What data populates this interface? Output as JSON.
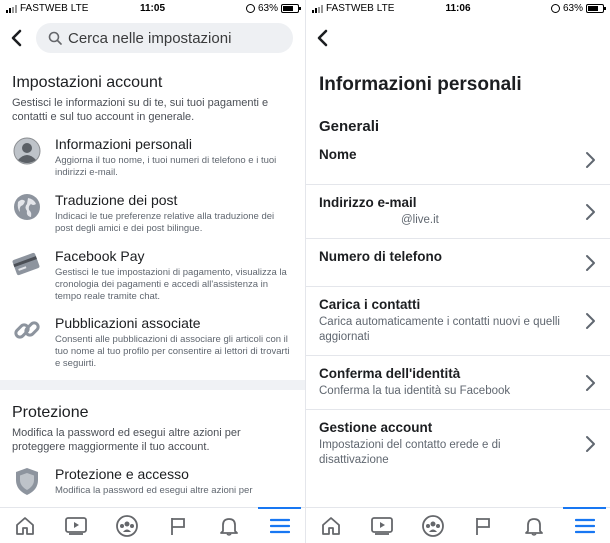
{
  "status_left": {
    "carrier": "FASTWEB",
    "network": "LTE",
    "time": "11:05",
    "battery": "63%"
  },
  "status_right": {
    "carrier": "FASTWEB",
    "network": "LTE",
    "time": "11:06",
    "battery": "63%"
  },
  "search": {
    "placeholder": "Cerca nelle impostazioni"
  },
  "settings": {
    "account": {
      "title": "Impostazioni account",
      "desc": "Gestisci le informazioni su di te, sui tuoi pagamenti e contatti e sul tuo account in generale.",
      "items": [
        {
          "label": "Informazioni personali",
          "desc": "Aggiorna il tuo nome, i tuoi numeri di telefono e i tuoi indirizzi e-mail.",
          "icon": "person-icon"
        },
        {
          "label": "Traduzione dei post",
          "desc": "Indicaci le tue preferenze relative alla traduzione dei post degli amici e dei post bilingue.",
          "icon": "globe-icon"
        },
        {
          "label": "Facebook Pay",
          "desc": "Gestisci le tue impostazioni di pagamento, visualizza la cronologia dei pagamenti e accedi all'assistenza in tempo reale tramite chat.",
          "icon": "credit-card-icon"
        },
        {
          "label": "Pubblicazioni associate",
          "desc": "Consenti alle pubblicazioni di associare gli articoli con il tuo nome al tuo profilo per consentire ai lettori di trovarti e seguirti.",
          "icon": "link-icon"
        }
      ]
    },
    "security": {
      "title": "Protezione",
      "desc": "Modifica la password ed esegui altre azioni per proteggere maggiormente il tuo account.",
      "items": [
        {
          "label": "Protezione e accesso",
          "desc": "Modifica la password ed esegui altre azioni per",
          "icon": "shield-icon"
        }
      ]
    }
  },
  "personal": {
    "title": "Informazioni personali",
    "group": "Generali",
    "rows": [
      {
        "label": "Nome",
        "sub": ""
      },
      {
        "label": "Indirizzo e-mail",
        "sub": "@live.it"
      },
      {
        "label": "Numero di telefono",
        "sub": ""
      },
      {
        "label": "Carica i contatti",
        "sub": "Carica automaticamente i contatti nuovi e quelli aggiornati"
      },
      {
        "label": "Conferma dell'identità",
        "sub": "Conferma la tua identità su Facebook"
      },
      {
        "label": "Gestione account",
        "sub": "Impostazioni del contatto erede e di disattivazione"
      }
    ]
  },
  "tabbar": [
    "home-icon",
    "watch-icon",
    "groups-icon",
    "pages-flag-icon",
    "notifications-bell-icon",
    "menu-icon"
  ],
  "colors": {
    "accent": "#1877f2",
    "text": "#1c1e21",
    "secondary": "#606770",
    "search_bg": "#eef0f3"
  }
}
